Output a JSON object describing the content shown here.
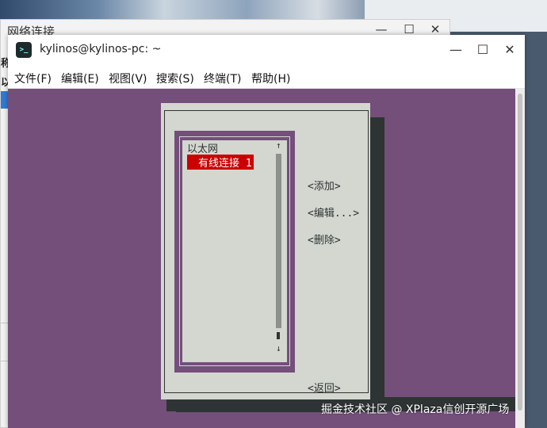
{
  "background_window": {
    "title": "网络连接",
    "minimize": "—",
    "maximize": "☐",
    "close": "✕",
    "side_label_1": "称",
    "side_label_2": "以"
  },
  "terminal": {
    "title": "kylinos@kylinos-pc: ~",
    "icon_glyph": ">_",
    "controls": {
      "minimize": "—",
      "maximize": "☐",
      "close": "✕"
    },
    "menu": [
      "文件(F)",
      "编辑(E)",
      "视图(V)",
      "搜索(S)",
      "终端(T)",
      "帮助(H)"
    ]
  },
  "nmtui": {
    "list_header": "以太网",
    "selected_connection": "有线连接 1",
    "scroll_up": "↑",
    "scroll_down": "↓",
    "actions": {
      "add": "<添加>",
      "edit": "<编辑...>",
      "delete": "<删除>",
      "back": "<返回>"
    }
  },
  "watermark": "掘金技术社区 @ XPlaza信创开源广场",
  "colors": {
    "terminal_bg": "#734f7a",
    "dialog_bg": "#d3d7cf",
    "selection": "#cc0000",
    "shadow": "#2e3434"
  }
}
